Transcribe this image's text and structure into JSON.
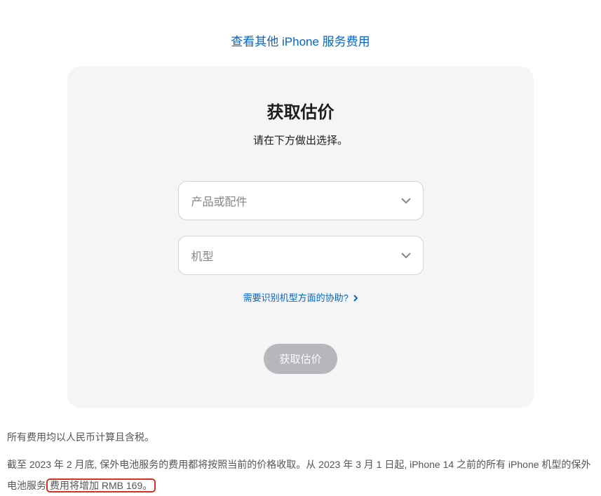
{
  "top_link": "查看其他 iPhone 服务费用",
  "card": {
    "title": "获取估价",
    "subtitle": "请在下方做出选择。",
    "select1_placeholder": "产品或配件",
    "select2_placeholder": "机型",
    "help_link": "需要识别机型方面的协助?",
    "submit_button": "获取估价"
  },
  "footer": {
    "line1": "所有费用均以人民币计算且含税。",
    "line2_part1": "截至 2023 年 2 月底, 保外电池服务的费用都将按照当前的价格收取。从 2023 年 3 月 1 日起, iPhone 14 之前的所有 iPhone 机型的保外电池服务",
    "line2_highlight": "费用将增加 RMB 169。"
  }
}
